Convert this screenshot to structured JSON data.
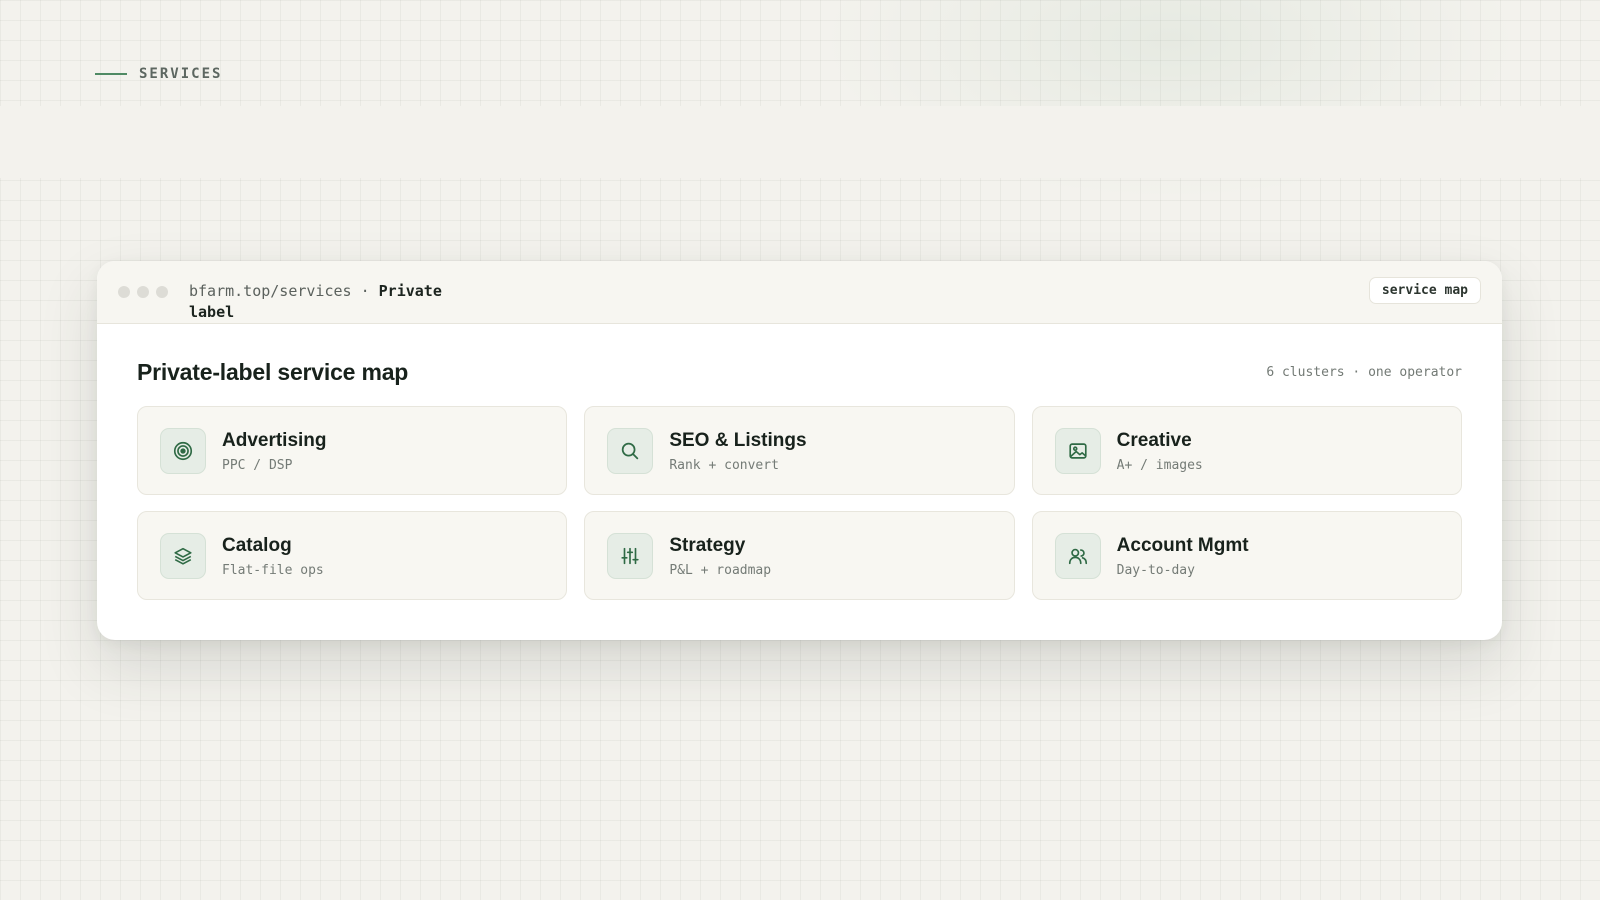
{
  "section_label": "SERVICES",
  "window": {
    "url": "bfarm.top/services",
    "separator": " · ",
    "page": "Private label",
    "tag": "service map"
  },
  "content": {
    "title": "Private-label service map",
    "meta": "6 clusters · one operator"
  },
  "services": [
    {
      "title": "Advertising",
      "subtitle": "PPC / DSP",
      "icon": "target-icon"
    },
    {
      "title": "SEO & Listings",
      "subtitle": "Rank + convert",
      "icon": "search-icon"
    },
    {
      "title": "Creative",
      "subtitle": "A+ / images",
      "icon": "image-icon"
    },
    {
      "title": "Catalog",
      "subtitle": "Flat-file ops",
      "icon": "layers-icon"
    },
    {
      "title": "Strategy",
      "subtitle": "P&L + roadmap",
      "icon": "sliders-icon"
    },
    {
      "title": "Account Mgmt",
      "subtitle": "Day-to-day",
      "icon": "users-icon"
    }
  ],
  "colors": {
    "accent": "#4f8a64",
    "icon_stroke": "#2f6a45",
    "background": "#f3f2ed"
  }
}
